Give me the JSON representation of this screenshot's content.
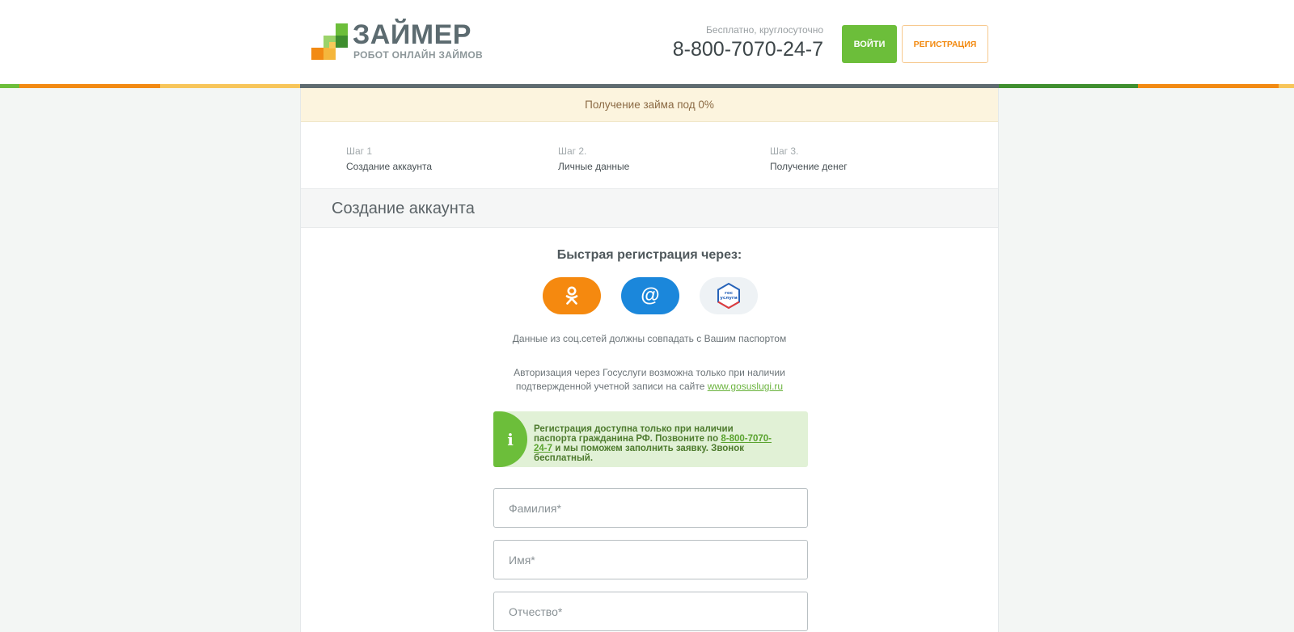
{
  "header": {
    "logo_title": "ЗАЙМЕР",
    "logo_subtitle": "РОБОТ ОНЛАЙН ЗАЙМОВ",
    "hours": "Бесплатно, круглосуточно",
    "phone": "8-800-7070-24-7",
    "login_label": "ВОЙТИ",
    "register_label": "РЕГИСТРАЦИЯ"
  },
  "promo_banner": "Получение займа под 0%",
  "steps": [
    {
      "label": "Шаг 1",
      "title": "Создание аккаунта"
    },
    {
      "label": "Шаг 2.",
      "title": "Личные данные"
    },
    {
      "label": "Шаг 3.",
      "title": "Получение денег"
    }
  ],
  "section_title": "Создание аккаунта",
  "quick_registration": {
    "title": "Быстрая регистрация через:",
    "providers": [
      {
        "name": "odnoklassniki",
        "icon": "ok-icon",
        "color": "#f5890f"
      },
      {
        "name": "mail",
        "icon": "at-icon",
        "glyph": "@",
        "color": "#1b87db"
      },
      {
        "name": "gosuslugi",
        "icon": "gosuslugi-icon",
        "badge_text": "гос услуги",
        "color": "#eef2f5"
      }
    ]
  },
  "notes": {
    "passport_match": "Данные из соц.сетей должны совпадать с Вашим паспортом",
    "gosuslugi_prefix": "Авторизация через Госуслуги возможна только при наличии подтвержденной учетной записи на сайте ",
    "gosuslugi_link": "www.gosuslugi.ru"
  },
  "info_box": {
    "icon": "info-icon",
    "text_before": "Регистрация доступна только при наличии паспорта гражданина РФ. Позвоните по ",
    "phone_link": "8-800-7070-24-7",
    "text_after": " и мы поможем заполнить заявку. Звонок бесплатный."
  },
  "form": {
    "last_name": {
      "placeholder": "Фамилия*",
      "value": ""
    },
    "first_name": {
      "placeholder": "Имя*",
      "value": ""
    },
    "middle_name": {
      "placeholder": "Отчество*",
      "value": ""
    }
  },
  "colors": {
    "accent_green": "#6cbe3a",
    "accent_orange": "#f2890f",
    "text_dark": "#4f585c",
    "promo_bg": "#fcf4de"
  }
}
